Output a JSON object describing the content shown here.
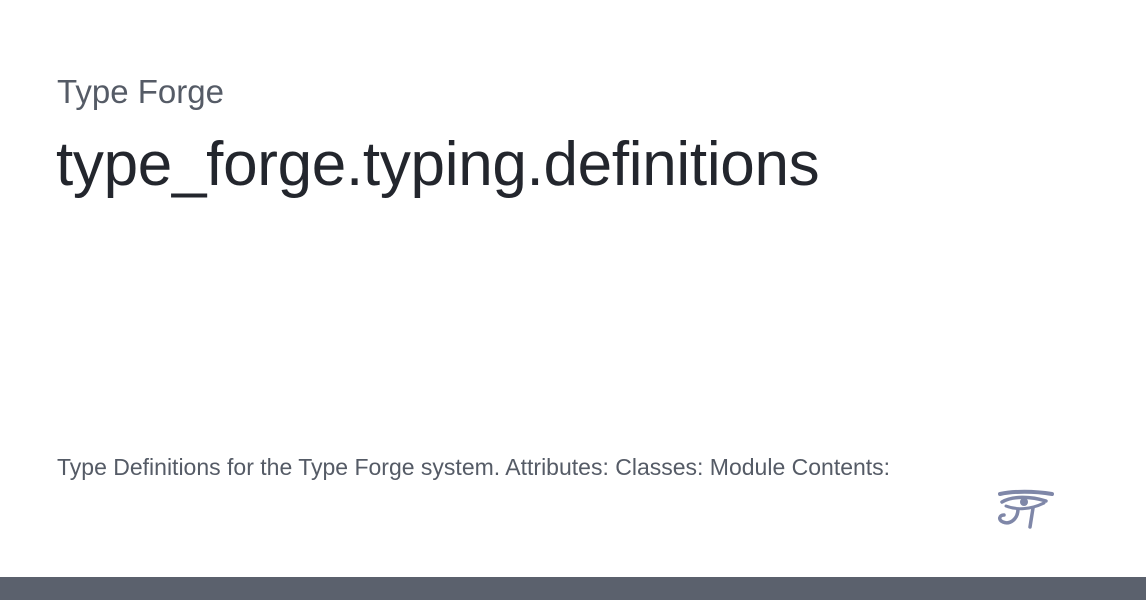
{
  "site": {
    "name": "Type Forge"
  },
  "page": {
    "title": "type_forge.typing.definitions",
    "description": "Type Definitions for the Type Forge system. Attributes: Classes: Module Contents:"
  },
  "logo": {
    "icon": "eye-of-horus-icon",
    "color": "#7f87a8"
  },
  "footer": {
    "color": "#5b616d"
  }
}
